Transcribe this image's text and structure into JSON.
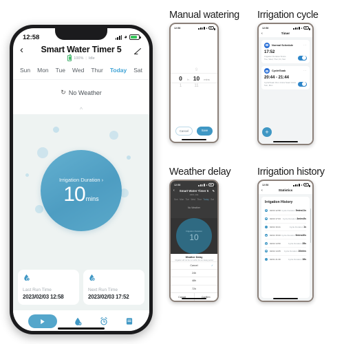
{
  "colors": {
    "accent": "#3f97c4",
    "dial": "#549fc4",
    "today": "#3fa3d6",
    "battery_green": "#34c759",
    "schedule_blue": "#2a6fd6"
  },
  "main_phone": {
    "status_bar": {
      "time": "12:58"
    },
    "nav": {
      "back_icon": "chevron-left-icon",
      "title": "Smart Water Timer 5",
      "edit_icon": "pencil-icon"
    },
    "subtitle": {
      "battery": "100%",
      "separator": "|",
      "state": "Idle"
    },
    "week": [
      {
        "label": "Sun",
        "today": false
      },
      {
        "label": "Mon",
        "today": false
      },
      {
        "label": "Tue",
        "today": false
      },
      {
        "label": "Wed",
        "today": false
      },
      {
        "label": "Thur",
        "today": false
      },
      {
        "label": "Today",
        "today": true
      },
      {
        "label": "Sat",
        "today": false
      }
    ],
    "weather": {
      "icon": "refresh-icon",
      "text": "No Weather"
    },
    "pull_handle": "^",
    "dial": {
      "label": "Irrigation Duration",
      "chevron": "›",
      "value": "10",
      "unit": "mins"
    },
    "run_cards": [
      {
        "icon": "water-drop-clock-icon",
        "label": "Last Run Time",
        "value": "2023/02/03 12:58"
      },
      {
        "icon": "water-drop-next-icon",
        "label": "Next Run Time",
        "value": "2023/02/03 17:52"
      }
    ],
    "tabs": [
      {
        "name": "play",
        "icon": "play-icon",
        "active": true
      },
      {
        "name": "manual",
        "icon": "water-drop-icon",
        "active": false
      },
      {
        "name": "timer",
        "icon": "alarm-clock-icon",
        "active": false
      },
      {
        "name": "history",
        "icon": "list-icon",
        "active": false
      }
    ]
  },
  "panels": {
    "manual": {
      "title": "Manual watering",
      "status_time": "12:58",
      "picker": {
        "ghost_top_hour": "",
        "ghost_top_min": "9",
        "hour": "0",
        "hour_unit": "h",
        "minute": "10",
        "minute_unit": "mins",
        "ghost_bottom_hour": "1",
        "ghost_bottom_min": "11"
      },
      "buttons": {
        "cancel": "Cancel",
        "save": "Save"
      }
    },
    "cycle": {
      "title": "Irrigation cycle",
      "status_time": "12:58",
      "nav_title": "Timer",
      "add_button": "+",
      "schedules": [
        {
          "badge_icon": "normal-schedule-icon",
          "name": "Normal Schedule",
          "more": "···",
          "time": "17:52",
          "meta": "Irrigation Duration 5mins",
          "days": "Tue, Wed, Thur, Fri, Sat",
          "enabled": true
        },
        {
          "badge_icon": "cycle-soak-icon",
          "name": "Cycle/Soak",
          "more": "···",
          "time": "20:44 - 21:44",
          "meta": "Cycle/Soak: Run 1mins Soak 1mins",
          "days": "Sun, Mon",
          "enabled": true
        }
      ]
    },
    "weather": {
      "title": "Weather delay",
      "status_time": "12:58",
      "bg_nav_title": "Smart Water Timer 5",
      "bg_subtitle": "100%  |  Idle",
      "bg_week": [
        "Sun",
        "Mon",
        "Tue",
        "Wed",
        "Thur",
        "Today",
        "Sat"
      ],
      "bg_weather": "No Weather",
      "bg_dial_label": "Irrigation Duration",
      "bg_dial_value": "10",
      "sheet": {
        "title": "Weather Delay",
        "description": "Irrigation will not be run within the set delay period",
        "options": [
          {
            "label": "Cancel",
            "selected": true
          },
          {
            "label": "24h",
            "selected": false
          },
          {
            "label": "48h",
            "selected": false
          },
          {
            "label": "72h",
            "selected": false
          }
        ],
        "footer": {
          "cancel": "Cancel",
          "confirm": "Confirm"
        }
      }
    },
    "history": {
      "title": "Irrigation history",
      "status_time": "12:58",
      "nav_title": "Statistics",
      "card_title": "Irrigation History",
      "columns": [
        "date",
        "duration"
      ],
      "rows": [
        {
          "date": "02/03 12:58",
          "duration_label": "Cycle Duration",
          "duration": "5mins11s"
        },
        {
          "date": "02/03 17:03",
          "duration_label": "Cycle Duration",
          "duration": "3mins5s"
        },
        {
          "date": "02/02 16:21",
          "duration_label": "Cycle Duration",
          "duration": "1s"
        },
        {
          "date": "02/02 15:00",
          "duration_label": "Cycle Duration",
          "duration": "9mins40s"
        },
        {
          "date": "02/02 14:50",
          "duration_label": "Cycle Duration",
          "duration": "28s"
        },
        {
          "date": "02/02 14:05",
          "duration_label": "Cycle Duration",
          "duration": "10mins"
        },
        {
          "date": "02/01 21:36",
          "duration_label": "Cycle Duration",
          "duration": "18s"
        }
      ]
    }
  }
}
